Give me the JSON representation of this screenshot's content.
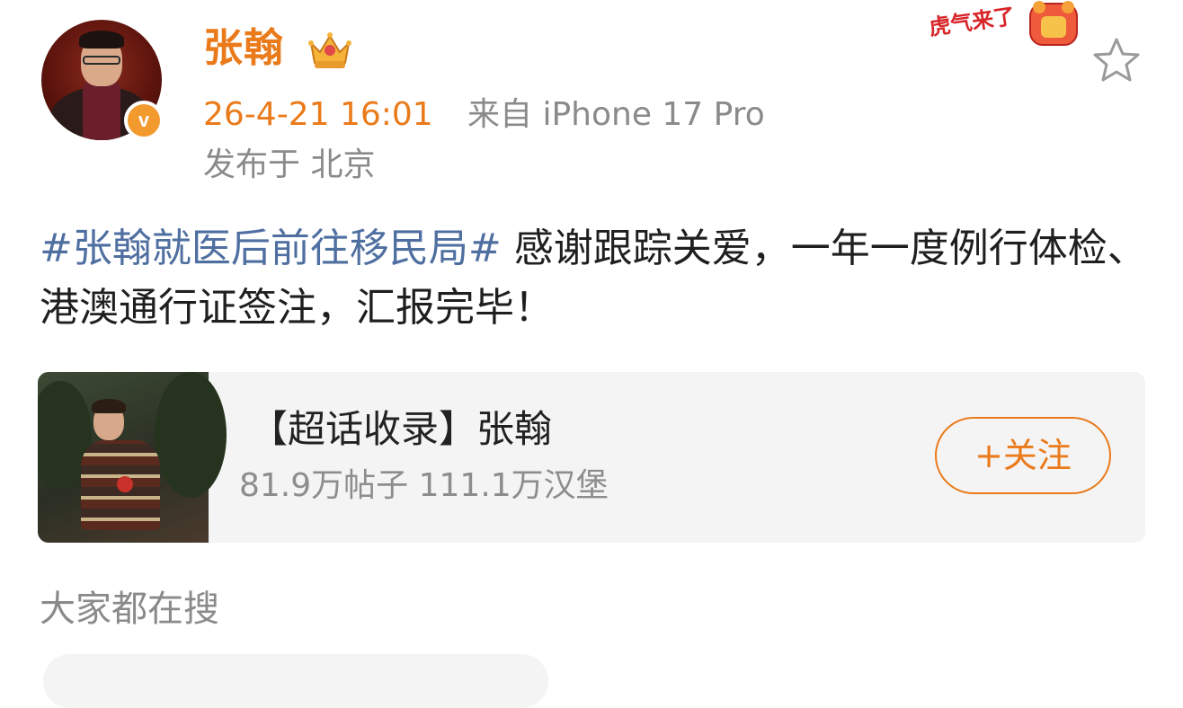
{
  "post": {
    "username": "张翰",
    "time": "26-4-21 16:01",
    "source": "来自 iPhone 17 Pro",
    "location": "发布于 北京",
    "hashtag": "#张翰就医后前往移民局#",
    "body": " 感谢跟踪关爱，一年一度例行体检、港澳通行证签注，汇报完毕！",
    "sticker_text": "虎气来了"
  },
  "card": {
    "title": "【超话收录】张翰",
    "stats": "81.9万帖子 111.1万汉堡",
    "follow_label": "+关注"
  },
  "section": {
    "title": "大家都在搜"
  },
  "colors": {
    "accent": "#ea7a1a",
    "hashtag": "#4f6fa0",
    "muted": "#8a8a8a",
    "card_bg": "#f4f4f4"
  },
  "icons": [
    "crown-icon",
    "verified-v-icon",
    "star-icon",
    "tiger-sticker"
  ]
}
